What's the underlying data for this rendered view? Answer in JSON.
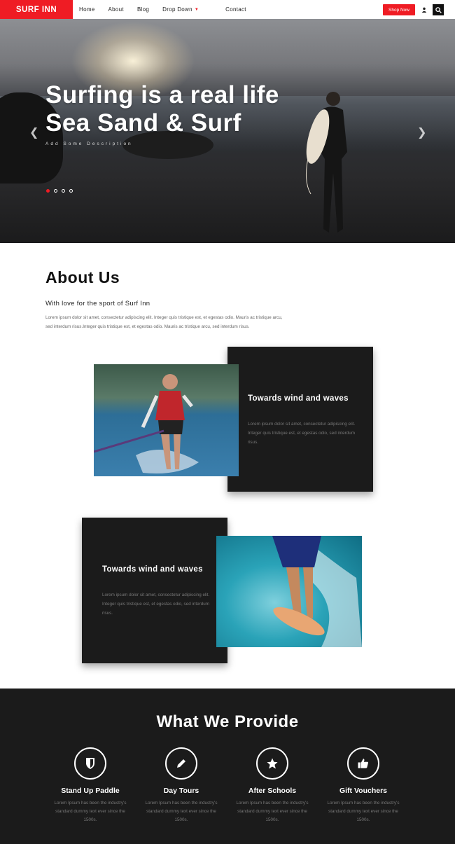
{
  "nav": {
    "logo": "SURF INN",
    "items": [
      "Home",
      "About",
      "Blog",
      "Drop Down",
      "Contact"
    ],
    "shop_label": "Shop Now"
  },
  "hero": {
    "title_line1": "Surfing is a real life",
    "title_line2": "Sea Sand & Surf",
    "caption": "Add Some Description",
    "slides": 4,
    "active_slide": 1
  },
  "about": {
    "title": "About Us",
    "subtitle": "With love for the sport of Surf Inn",
    "body": "Lorem ipsum dolor sit amet, consectetur adipiscing elit. Integer quis tristique est, et egestas odio. Mauris ac tristique arcu, sed interdum risus.Integer quis tristique est, et egestas odio. Mauris ac tristique arcu, sed interdum risus."
  },
  "cards": [
    {
      "title": "Towards wind and waves",
      "body": "Lorem ipsum dolor sit amet, consectetur adipiscing elit. Integer quis tristique est, et egestas odio, sed interdum risus."
    },
    {
      "title": "Towards wind and waves",
      "body": "Lorem ipsum dolor sit amet, consectetur adipiscing elit. Integer quis tristique est, et egestas odio, sed interdum risus."
    }
  ],
  "provide": {
    "title": "What We Provide",
    "features": [
      {
        "icon": "shield-icon",
        "title": "Stand Up Paddle",
        "desc": "Lorem Ipsum has been the industry's standard dummy text ever since the 1500s."
      },
      {
        "icon": "pencil-icon",
        "title": "Day Tours",
        "desc": "Lorem Ipsum has been the industry's standard dummy text ever since the 1500s."
      },
      {
        "icon": "star-icon",
        "title": "After Schools",
        "desc": "Lorem Ipsum has been the industry's standard dummy text ever since the 1500s."
      },
      {
        "icon": "thumbs-up-icon",
        "title": "Gift Vouchers",
        "desc": "Lorem Ipsum has been the industry's standard dummy text ever since the 1500s."
      }
    ]
  },
  "colors": {
    "accent": "#ef1c24",
    "dark": "#1b1b1b"
  }
}
